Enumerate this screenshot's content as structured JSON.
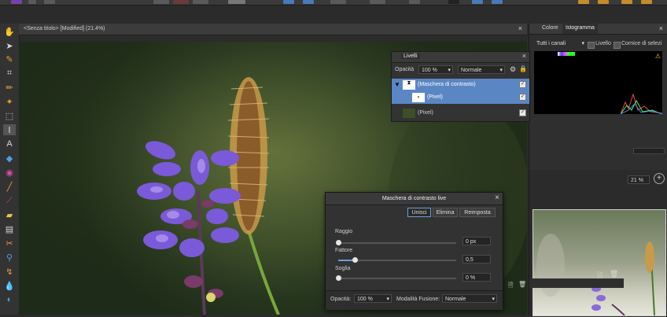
{
  "document": {
    "title": "<Senza titolo> [Modified] (21.4%)"
  },
  "right_dock": {
    "tabs": [
      "Colore",
      "Istogramma"
    ],
    "channel_select": "Tutti i canali",
    "level_label": "Livello",
    "frame_label": "Cornice di selezi",
    "zoom_value": "21 %"
  },
  "layers": {
    "title": "Livelli",
    "opacity_label": "Opacità",
    "opacity_value": "100 %",
    "blend_value": "Normale",
    "items": [
      {
        "label": "(Maschera di contrasto)"
      },
      {
        "label": "(Pixel)"
      },
      {
        "label": "(Pixel)"
      }
    ]
  },
  "dialog": {
    "title": "Maschera di contrasto live",
    "buttons": {
      "merge": "Unisci",
      "delete": "Elimina",
      "reset": "Reimposta"
    },
    "radius": {
      "label": "Raggio",
      "value": "0 px",
      "fraction": 0.0
    },
    "factor": {
      "label": "Fattore",
      "value": "0,5",
      "fraction": 0.14
    },
    "threshold": {
      "label": "Soglia",
      "value": "0 %",
      "fraction": 0.0
    },
    "opacity_label": "Opacità:",
    "opacity_value": "100 %",
    "blend_label": "Modalità Fusione:",
    "blend_value": "Normale"
  },
  "colors": {
    "accent": "#6a9fd8",
    "selected_row": "#5b86c4",
    "panel": "#333333"
  }
}
